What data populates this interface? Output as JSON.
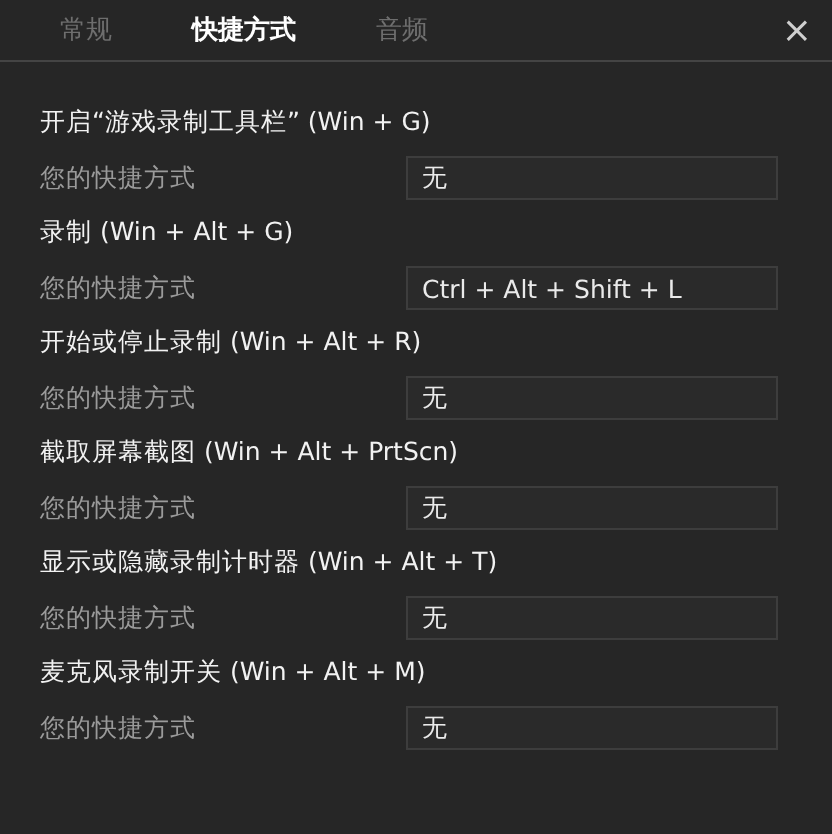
{
  "tabs": [
    {
      "label": "常规",
      "selected": false
    },
    {
      "label": "快捷方式",
      "selected": true
    },
    {
      "label": "音频",
      "selected": false
    }
  ],
  "close": "×",
  "shortcuts": [
    {
      "title": "开启“游戏录制工具栏” (Win + G)",
      "label": "您的快捷方式",
      "value": "无"
    },
    {
      "title": "录制 (Win + Alt + G)",
      "label": "您的快捷方式",
      "value": "Ctrl + Alt + Shift + L"
    },
    {
      "title": "开始或停止录制 (Win + Alt + R)",
      "label": "您的快捷方式",
      "value": "无"
    },
    {
      "title": "截取屏幕截图 (Win + Alt + PrtScn)",
      "label": "您的快捷方式",
      "value": "无"
    },
    {
      "title": "显示或隐藏录制计时器 (Win + Alt + T)",
      "label": "您的快捷方式",
      "value": "无"
    },
    {
      "title": "麦克风录制开关 (Win + Alt + M)",
      "label": "您的快捷方式",
      "value": "无"
    }
  ]
}
